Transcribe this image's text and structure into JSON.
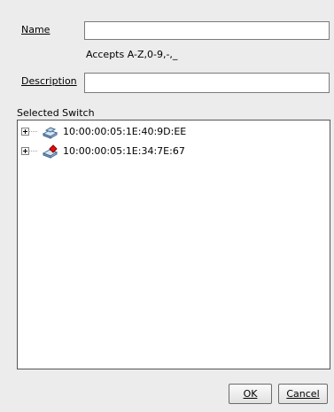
{
  "form": {
    "name_label": "Name",
    "name_value": "",
    "name_hint": "Accepts A-Z,0-9,-,_",
    "description_label": "Description",
    "description_value": ""
  },
  "tree": {
    "title": "Selected Switch",
    "items": [
      {
        "label": "10:00:00:05:1E:40:9D:EE",
        "icon": "switch-icon"
      },
      {
        "label": "10:00:00:05:1E:34:7E:67",
        "icon": "switch-alert-icon"
      }
    ]
  },
  "buttons": {
    "ok": "OK",
    "cancel": "Cancel"
  }
}
